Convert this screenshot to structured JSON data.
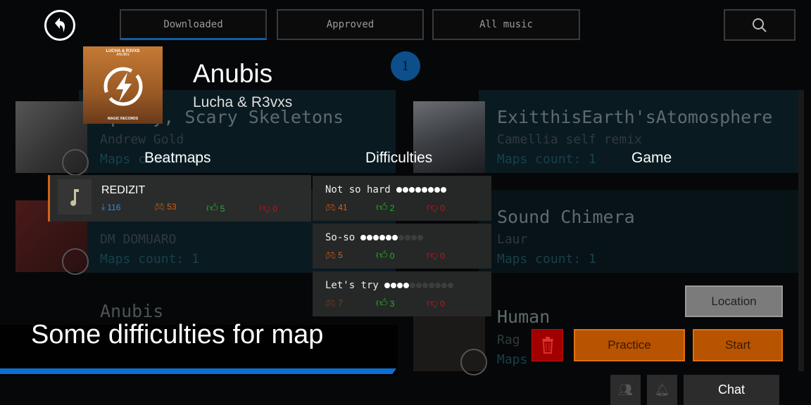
{
  "tabs": [
    {
      "label": "Downloaded",
      "active": true
    },
    {
      "label": "Approved",
      "active": false
    },
    {
      "label": "All music",
      "active": false
    }
  ],
  "selected": {
    "title": "Anubis",
    "artist": "Lucha & R3vxs",
    "cover_text": {
      "top": "LUCHA & R3VXS",
      "name": "ANUBIS",
      "label": "MAGIC RECORDS"
    },
    "badge": "1"
  },
  "background_list": {
    "left": [
      {
        "title": "Spooky, Scary Skeletons",
        "artist": "Andrew Gold",
        "maps": "Maps count: 1"
      },
      {
        "title": "",
        "artist": "DM DOMUARO",
        "maps": "Maps count: 1"
      },
      {
        "title": "Anubis",
        "artist": "",
        "maps": ""
      }
    ],
    "right": [
      {
        "title": "ExitthisEarth'sAtomosphere",
        "artist": "Camellia self remix",
        "maps": "Maps count: 1"
      },
      {
        "title": "Sound Chimera",
        "artist": "Laur",
        "maps": "Maps count: 1"
      },
      {
        "title": "Human",
        "artist": "Rag",
        "maps": "Maps"
      }
    ]
  },
  "sections": {
    "beatmaps": "Beatmaps",
    "difficulties": "Difficulties",
    "game": "Game"
  },
  "beatmap": {
    "name": "REDIZIT",
    "downloads": "116",
    "plays": "53",
    "likes": "5",
    "dislikes": "0"
  },
  "difficulties": [
    {
      "name": "Not so hard",
      "rating": 8,
      "max": 8,
      "plays": "41",
      "likes": "2",
      "dislikes": "0"
    },
    {
      "name": "So-so",
      "rating": 6,
      "max": 10,
      "plays": "5",
      "likes": "0",
      "dislikes": "0"
    },
    {
      "name": "Let's try",
      "rating": 4,
      "max": 11,
      "plays": "7",
      "likes": "3",
      "dislikes": "0"
    }
  ],
  "buttons": {
    "location": "Location",
    "practice": "Practice",
    "start": "Start",
    "chat": "Chat"
  },
  "caption": "Some difficulties for map",
  "colors": {
    "accent": "#0d6fd1",
    "orange": "#c05a00",
    "blue_stat": "#2d8fe0",
    "orange_stat": "#d4621a",
    "green": "#1fb52c",
    "red": "#d0101a"
  }
}
